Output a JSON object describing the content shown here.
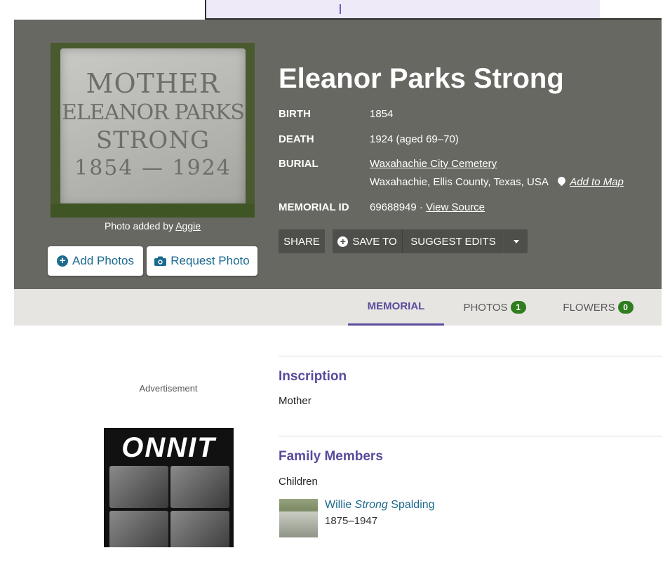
{
  "memorial": {
    "name": "Eleanor Parks Strong",
    "birth_label": "BIRTH",
    "birth_value": "1854",
    "death_label": "DEATH",
    "death_value": "1924 (aged 69–70)",
    "burial_label": "BURIAL",
    "burial_cemetery": "Waxahachie City Cemetery",
    "burial_location": "Waxahachie, Ellis County, Texas, USA",
    "add_to_map": "Add to Map",
    "memorial_id_label": "MEMORIAL ID",
    "memorial_id_value": "69688949",
    "id_separator": "·",
    "view_source": "View Source"
  },
  "photo": {
    "stone_lines": [
      "MOTHER",
      "ELEANOR PARKS",
      "STRONG",
      "1854 — 1924"
    ],
    "credit_prefix": "Photo added by",
    "credit_user": "Aggie",
    "add_photos": "Add Photos",
    "request_photo": "Request Photo"
  },
  "actions": {
    "share": "SHARE",
    "save_to": "SAVE TO",
    "suggest_edits": "SUGGEST EDITS"
  },
  "tabs": {
    "memorial": "MEMORIAL",
    "photos": "PHOTOS",
    "photos_count": "1",
    "flowers": "FLOWERS",
    "flowers_count": "0"
  },
  "ad": {
    "label": "Advertisement",
    "brand": "ONNIT"
  },
  "inscription": {
    "heading": "Inscription",
    "text": "Mother"
  },
  "family": {
    "heading": "Family Members",
    "children_label": "Children",
    "child": {
      "first": "Willie",
      "middle": "Strong",
      "last": "Spalding",
      "dates": "1875–1947"
    }
  },
  "colors": {
    "hero_bg": "#686862",
    "accent_purple": "#5a4b9c",
    "link_blue": "#1c6a8f",
    "badge_green": "#2f7d1f"
  },
  "icons": [
    "plus-circle-icon",
    "camera-icon",
    "map-pin-icon",
    "chevron-down-icon"
  ]
}
